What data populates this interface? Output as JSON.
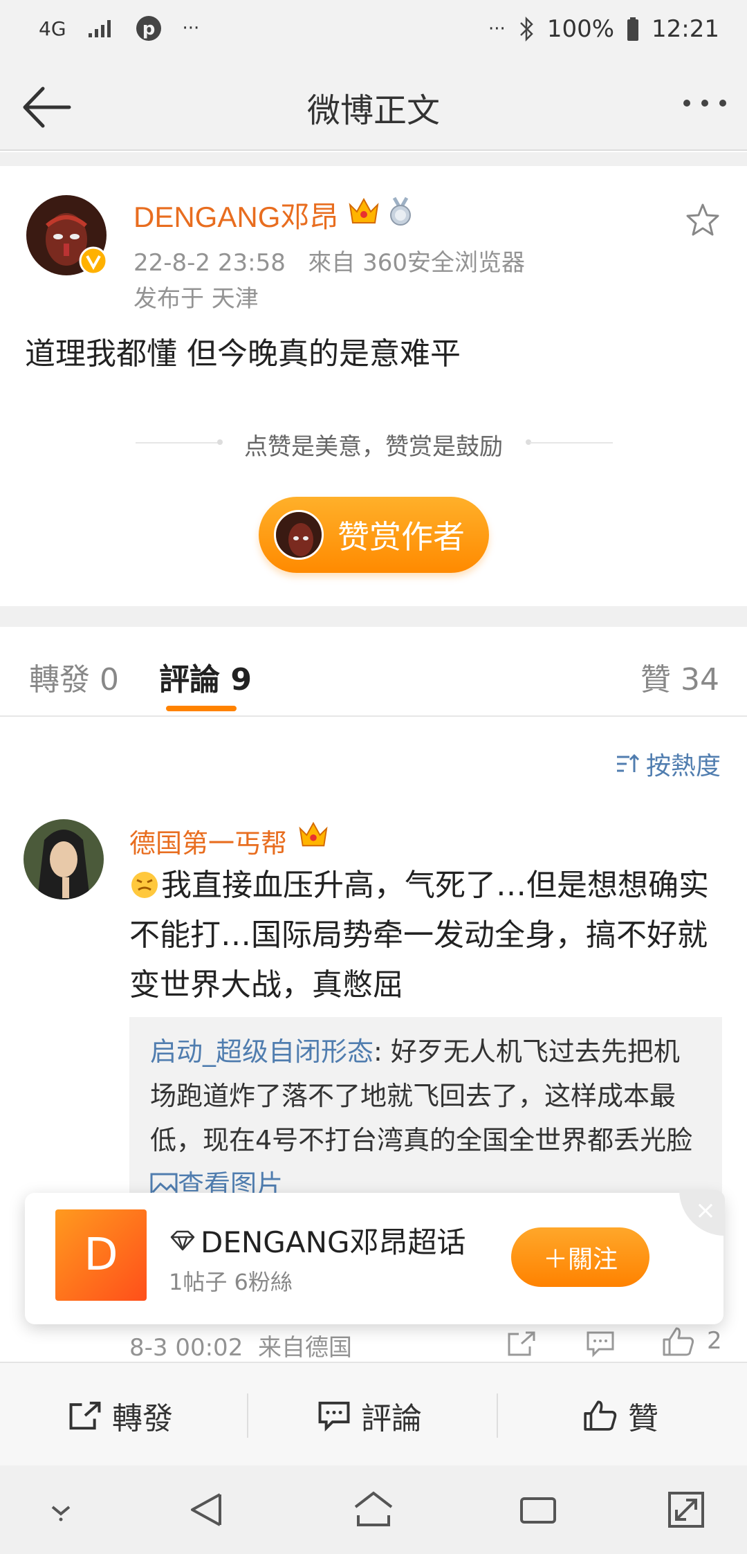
{
  "status_bar": {
    "network": "4G",
    "dots": "···",
    "dots_right": "···",
    "battery": "100%",
    "time": "12:21"
  },
  "header": {
    "title": "微博正文"
  },
  "post": {
    "author": "DENGANG邓昂",
    "timestamp": "22-8-2 23:58",
    "source": "來自 360安全浏览器",
    "location": "发布于 天津",
    "text": "道理我都懂 但今晚真的是意难平",
    "reward_hint": "点赞是美意，赞赏是鼓励",
    "reward_button": "赞赏作者"
  },
  "tabs": {
    "repost": "轉發 0",
    "comment": "評論 9",
    "like": "贊 34"
  },
  "sort": {
    "label": "按熱度"
  },
  "comment": {
    "user": "德国第一丐帮",
    "text": "我直接血压升高，气死了…但是想想确实不能打…国际局势牵一发动全身，搞不好就变世界大战，真憋屈",
    "reply_user": "启动_超级自闭形态",
    "reply_text": ": 好歹无人机飞过去先把机场跑道炸了落不了地就飞回去了，这样成本最低，现在4号不打台湾真的全国全世界都丢光脸 ",
    "reply_link": "查看图片",
    "time": "8-3 00:02",
    "source": "来自德国",
    "like_count": "2"
  },
  "popup": {
    "logo_letter": "D",
    "title": "DENGANG邓昂超话",
    "subtitle": "1帖子 6粉絲",
    "follow": "＋關注",
    "close": "×"
  },
  "bottom_bar": {
    "repost": "轉發",
    "comment": "評論",
    "like": "贊"
  },
  "colors": {
    "accent": "#ff8200",
    "name": "#e86d1f",
    "link": "#507daf"
  }
}
